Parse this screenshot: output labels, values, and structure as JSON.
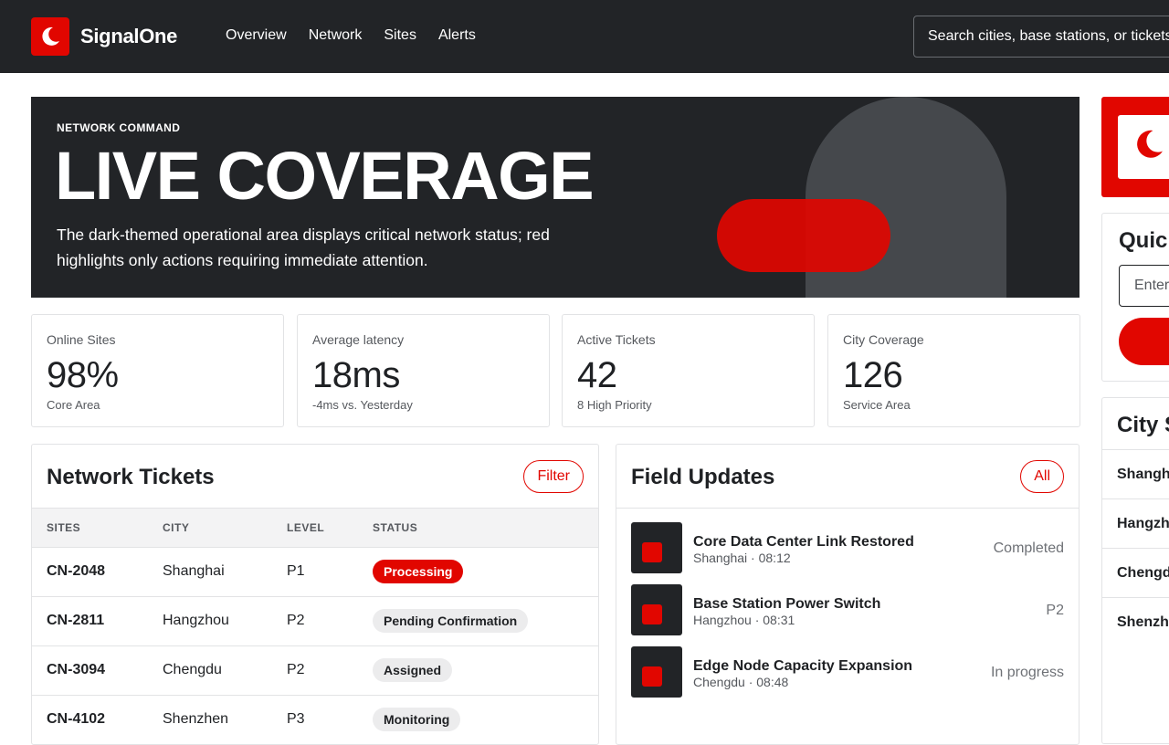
{
  "header": {
    "brand": "SignalOne",
    "nav": [
      "Overview",
      "Network",
      "Sites",
      "Alerts"
    ],
    "search_placeholder": "Search cities, base stations, or tickets"
  },
  "hero": {
    "eyebrow": "NETWORK COMMAND",
    "title": "LIVE COVERAGE",
    "description": "The dark-themed operational area displays critical network status; red highlights only actions requiring immediate attention."
  },
  "stats": [
    {
      "label": "Online Sites",
      "value": "98%",
      "sub": "Core Area"
    },
    {
      "label": "Average latency",
      "value": "18ms",
      "sub": "-4ms vs. Yesterday"
    },
    {
      "label": "Active Tickets",
      "value": "42",
      "sub": "8 High Priority"
    },
    {
      "label": "City Coverage",
      "value": "126",
      "sub": "Service Area"
    }
  ],
  "tickets": {
    "title": "Network Tickets",
    "filter_label": "Filter",
    "columns": [
      "SITES",
      "CITY",
      "LEVEL",
      "STATUS"
    ],
    "rows": [
      {
        "site": "CN-2048",
        "city": "Shanghai",
        "level": "P1",
        "status": "Processing"
      },
      {
        "site": "CN-2811",
        "city": "Hangzhou",
        "level": "P2",
        "status": "Pending Confirmation"
      },
      {
        "site": "CN-3094",
        "city": "Chengdu",
        "level": "P2",
        "status": "Assigned"
      },
      {
        "site": "CN-4102",
        "city": "Shenzhen",
        "level": "P3",
        "status": "Monitoring"
      }
    ]
  },
  "updates": {
    "title": "Field Updates",
    "all_label": "All",
    "items": [
      {
        "title": "Core Data Center Link Restored",
        "meta": "Shanghai · 08:12",
        "status": "Completed"
      },
      {
        "title": "Base Station Power Switch",
        "meta": "Hangzhou · 08:31",
        "status": "P2"
      },
      {
        "title": "Edge Node Capacity Expansion",
        "meta": "Chengdu · 08:48",
        "status": "In progress"
      }
    ]
  },
  "side": {
    "quick_title": "Quick",
    "quick_placeholder": "Enter",
    "city_title": "City S",
    "cities": [
      "Shangh",
      "Hangzh",
      "Chengd",
      "Shenzh"
    ]
  },
  "colors": {
    "accent": "#e10600",
    "dark": "#222427",
    "arch": "#45484c"
  }
}
